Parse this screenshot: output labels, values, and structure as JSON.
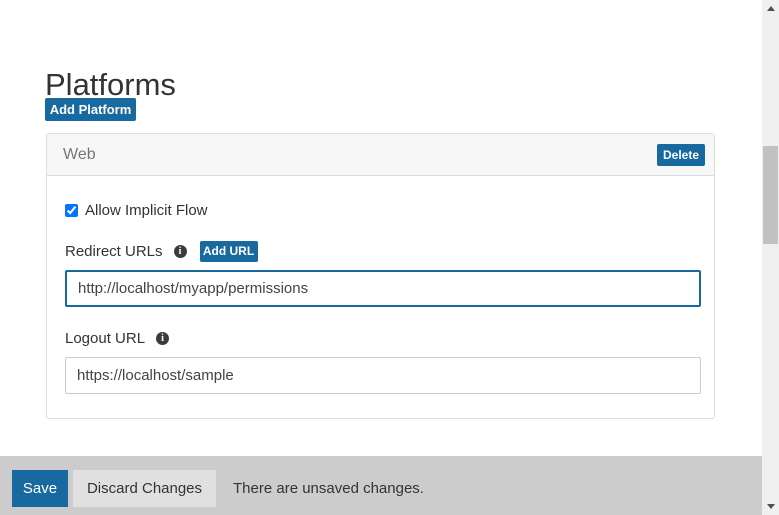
{
  "page": {
    "title": "Platforms"
  },
  "toolbar": {
    "add_platform_label": "Add Platform"
  },
  "platform_card": {
    "header_title": "Web",
    "delete_label": "Delete",
    "implicit_flow": {
      "label": "Allow Implicit Flow",
      "checked": true
    },
    "redirect_urls": {
      "label": "Redirect URLs",
      "info_icon": "info-icon",
      "info_glyph": "i",
      "add_url_label": "Add URL",
      "value": "http://localhost/myapp/permissions",
      "placeholder": "",
      "focused": true
    },
    "logout_url": {
      "label": "Logout URL",
      "info_icon": "info-icon",
      "info_glyph": "i",
      "value": "https://localhost/sample",
      "placeholder": "",
      "focused": false
    }
  },
  "action_bar": {
    "save_label": "Save",
    "discard_label": "Discard Changes",
    "status_message": "There are unsaved changes."
  },
  "scrollbar": {
    "up_arrow_icon": "chevron-up-icon",
    "down_arrow_icon": "chevron-down-icon"
  },
  "colors": {
    "accent_blue": "#18699f",
    "action_bar_gray": "#cccccc",
    "card_header_gray": "#f7f7f7",
    "border_gray": "#dddddd",
    "focus_border": "#19699f",
    "discard_button_gray": "#e0e0e0"
  }
}
